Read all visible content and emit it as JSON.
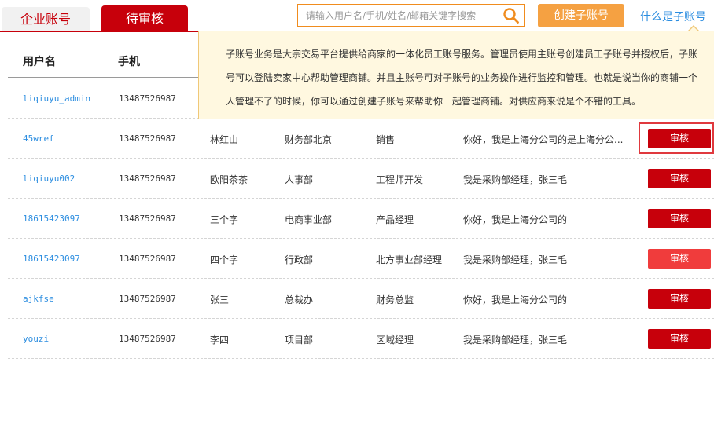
{
  "tabs": [
    {
      "label": "企业账号",
      "active": false
    },
    {
      "label": "待审核",
      "active": true
    }
  ],
  "search": {
    "placeholder": "请输入用户名/手机/姓名/邮箱关键字搜索"
  },
  "create_button": "创建子账号",
  "what_link": "什么是子账号",
  "table": {
    "headers": [
      "用户名",
      "手机"
    ],
    "action_label": "审核",
    "rows": [
      {
        "user": "liqiuyu_admin",
        "phone": "13487526987",
        "name": "",
        "dept": "",
        "title": "",
        "desc": ""
      },
      {
        "user": "45wref",
        "phone": "13487526987",
        "name": "林红山",
        "dept": "财务部北京",
        "title": "销售",
        "desc": "你好，我是上海分公司的是上海分公..."
      },
      {
        "user": "liqiuyu002",
        "phone": "13487526987",
        "name": "欧阳茶茶",
        "dept": "人事部",
        "title": "工程师开发",
        "desc": "我是采购部经理，张三毛"
      },
      {
        "user": "18615423097",
        "phone": "13487526987",
        "name": "三个字",
        "dept": "电商事业部",
        "title": "产品经理",
        "desc": "你好，我是上海分公司的"
      },
      {
        "user": "18615423097",
        "phone": "13487526987",
        "name": "四个字",
        "dept": "行政部",
        "title": "北方事业部经理",
        "desc": "我是采购部经理，张三毛"
      },
      {
        "user": "ajkfse",
        "phone": "13487526987",
        "name": "张三",
        "dept": "总裁办",
        "title": "财务总监",
        "desc": "你好，我是上海分公司的"
      },
      {
        "user": "youzi",
        "phone": "13487526987",
        "name": "李四",
        "dept": "项目部",
        "title": "区域经理",
        "desc": "我是采购部经理，张三毛"
      }
    ]
  },
  "tooltip": {
    "lines": [
      "子账号业务是大宗交易平台提供给商家的一体化员工账号服务。管理员使用主账号创建员工子账号并授权后，子账",
      "号可以登陆卖家中心帮助管理商铺。并且主账号可对子账号的业务操作进行监控和管理。也就是说当你的商铺一个",
      "人管理不了的时候，你可以通过创建子账号来帮助你一起管理商铺。对供应商来说是个不错的工具。"
    ]
  },
  "colors": {
    "brand_red": "#c7000b",
    "orange": "#f5a142",
    "link_blue": "#2d8ee0",
    "tooltip_bg": "#fff8e0"
  }
}
